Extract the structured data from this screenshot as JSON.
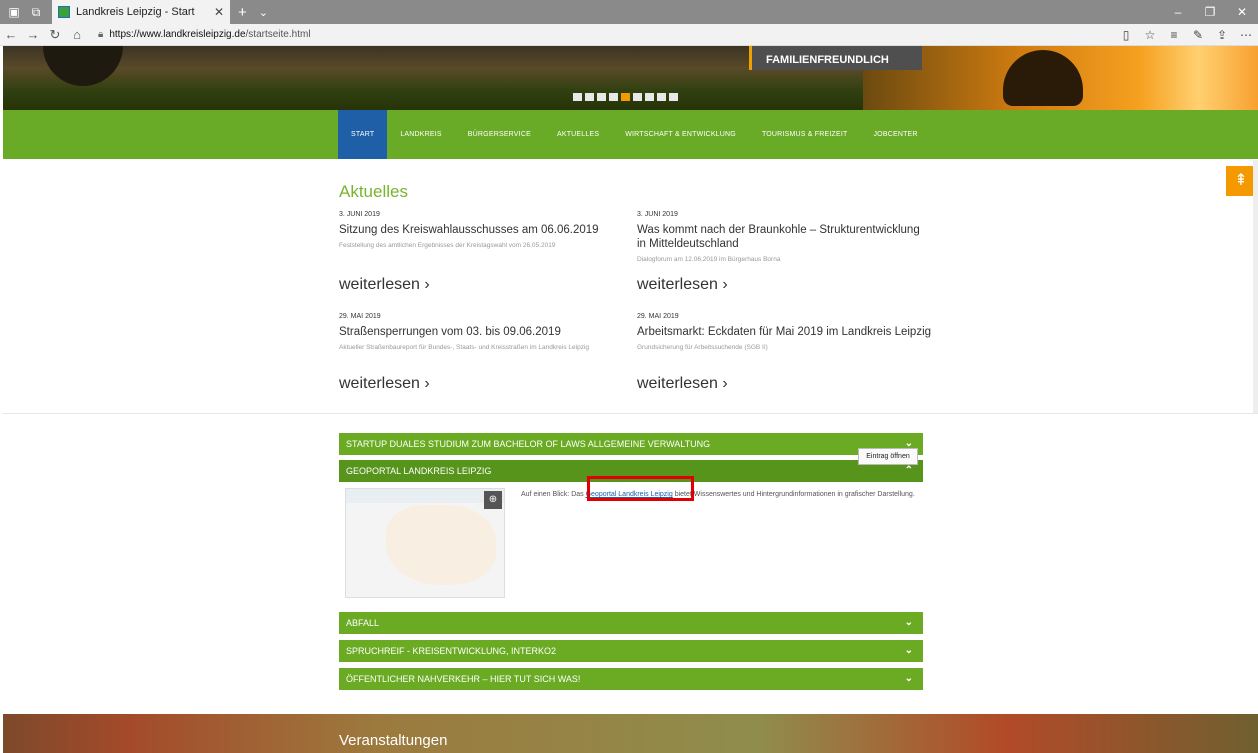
{
  "browser": {
    "tab_title": "Landkreis Leipzig - Start",
    "url_host": "https://www.landkreisleipzig.de",
    "url_path": "/startseite.html"
  },
  "hero": {
    "badge": "FAMILIENFREUNDLICH",
    "slider_total": 9,
    "slider_active": 5
  },
  "nav": {
    "items": [
      "START",
      "LANDKREIS",
      "BÜRGERSERVICE",
      "AKTUELLES",
      "WIRTSCHAFT & ENTWICKLUNG",
      "TOURISMUS & FREIZEIT",
      "JOBCENTER"
    ],
    "active": "START"
  },
  "news": {
    "title": "Aktuelles",
    "more_label": "weiterlesen ›",
    "items": [
      {
        "date": "3. JUNI 2019",
        "headline": "Sitzung des Kreiswahlausschusses am 06.06.2019",
        "teaser": "Feststellung des amtlichen Ergebnisses der Kreistagswahl vom 26.05.2019"
      },
      {
        "date": "3. JUNI 2019",
        "headline": "Was kommt nach der Braunkohle – Strukturentwicklung in Mitteldeutschland",
        "teaser": "Dialogforum am 12.06.2019 im Bürgerhaus Borna"
      },
      {
        "date": "29. MAI 2019",
        "headline": "Straßensperrungen vom 03. bis 09.06.2019",
        "teaser": "Aktueller Straßenbaureport für Bundes-, Staats- und Kreisstraßen im Landkreis Leipzig"
      },
      {
        "date": "29. MAI 2019",
        "headline": "Arbeitsmarkt: Eckdaten für Mai 2019 im Landkreis Leipzig",
        "teaser": "Grundsicherung für Arbeitssuchende (SGB II)"
      }
    ]
  },
  "accordion": {
    "items": [
      "STARTUP DUALES STUDIUM ZUM BACHELOR OF LAWS ALLGEMEINE VERWALTUNG",
      "GEOPORTAL LANDKREIS LEIPZIG",
      "ABFALL",
      "SPRUCHREIF - KREISENTWICKLUNG, INTERKO2",
      "ÖFFENTLICHER NAHVERKEHR – HIER TUT SICH WAS!"
    ],
    "tooltip": "Eintrag öffnen",
    "geoportal_text_before": "Auf einen Blick: Das ",
    "geoportal_link": "Geoportal Landkreis Leipzig",
    "geoportal_text_after": " bietet Wissenswertes und Hintergrundinformationen in grafischer Darstellung."
  },
  "footer": {
    "title": "Veranstaltungen"
  },
  "colors": {
    "green": "#69ab27",
    "blue": "#1f5fa8",
    "orange": "#f39a00"
  }
}
